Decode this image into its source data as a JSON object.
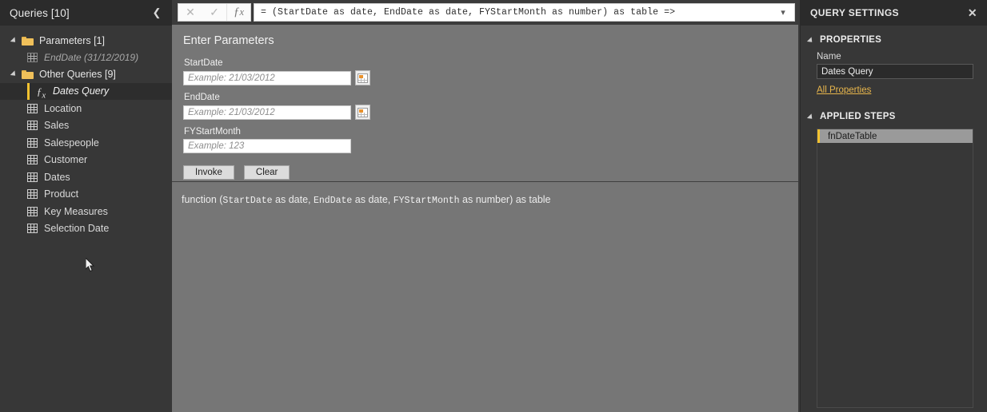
{
  "queries_pane": {
    "header_title": "Queries [10]",
    "collapse_icon": "chevron-left-icon",
    "groups": [
      {
        "label": "Parameters [1]",
        "items": [
          {
            "label": "EndDate (31/12/2019)",
            "icon": "table-icon",
            "kind": "parameter",
            "selected": false
          }
        ]
      },
      {
        "label": "Other Queries [9]",
        "items": [
          {
            "label": "Dates Query",
            "icon": "fx-icon",
            "kind": "function",
            "selected": true
          },
          {
            "label": "Location",
            "icon": "table-icon",
            "kind": "table",
            "selected": false
          },
          {
            "label": "Sales",
            "icon": "table-icon",
            "kind": "table",
            "selected": false
          },
          {
            "label": "Salespeople",
            "icon": "table-icon",
            "kind": "table",
            "selected": false
          },
          {
            "label": "Customer",
            "icon": "table-icon",
            "kind": "table",
            "selected": false
          },
          {
            "label": "Dates",
            "icon": "table-icon",
            "kind": "table",
            "selected": false
          },
          {
            "label": "Product",
            "icon": "table-icon",
            "kind": "table",
            "selected": false
          },
          {
            "label": "Key Measures",
            "icon": "table-icon",
            "kind": "table",
            "selected": false
          },
          {
            "label": "Selection Date",
            "icon": "table-icon",
            "kind": "table",
            "selected": false
          }
        ]
      }
    ]
  },
  "formula_bar": {
    "cancel_icon": "close-icon",
    "accept_icon": "checkmark-icon",
    "fx_icon": "fx-icon",
    "formula": "= (StartDate as date, EndDate as date, FYStartMonth as number) as table =>",
    "expand_icon": "chevron-down-icon"
  },
  "invoke_form": {
    "title": "Enter Parameters",
    "fields": [
      {
        "label": "StartDate",
        "value": "",
        "placeholder": "Example: 21/03/2012",
        "has_date_picker": true
      },
      {
        "label": "EndDate",
        "value": "",
        "placeholder": "Example: 21/03/2012",
        "has_date_picker": true
      },
      {
        "label": "FYStartMonth",
        "value": "",
        "placeholder": "Example: 123",
        "has_date_picker": false
      }
    ],
    "invoke_label": "Invoke",
    "clear_label": "Clear",
    "calendar_icon": "calendar-icon"
  },
  "signature": {
    "prefix": "function (",
    "p1_name": "StartDate",
    "p1_type": " as date, ",
    "p2_name": "EndDate",
    "p2_type": " as date, ",
    "p3_name": "FYStartMonth",
    "p3_type": " as number) as table"
  },
  "query_settings": {
    "header_title": "QUERY SETTINGS",
    "close_icon": "close-icon",
    "properties_section": "PROPERTIES",
    "name_label": "Name",
    "name_value": "Dates Query",
    "all_properties_link": "All Properties",
    "applied_steps_section": "APPLIED STEPS",
    "steps": [
      {
        "label": "fnDateTable",
        "selected": true
      }
    ]
  },
  "colors": {
    "panel_dark": "#373737",
    "header_dark": "#2b2b2b",
    "content_gray": "#767676",
    "accent_yellow": "#f2c230",
    "link_gold": "#e8b64c",
    "folder_gold": "#f0c05a",
    "calendar_orange": "#e8922e",
    "selected_step_bg": "#9a9a9a"
  }
}
